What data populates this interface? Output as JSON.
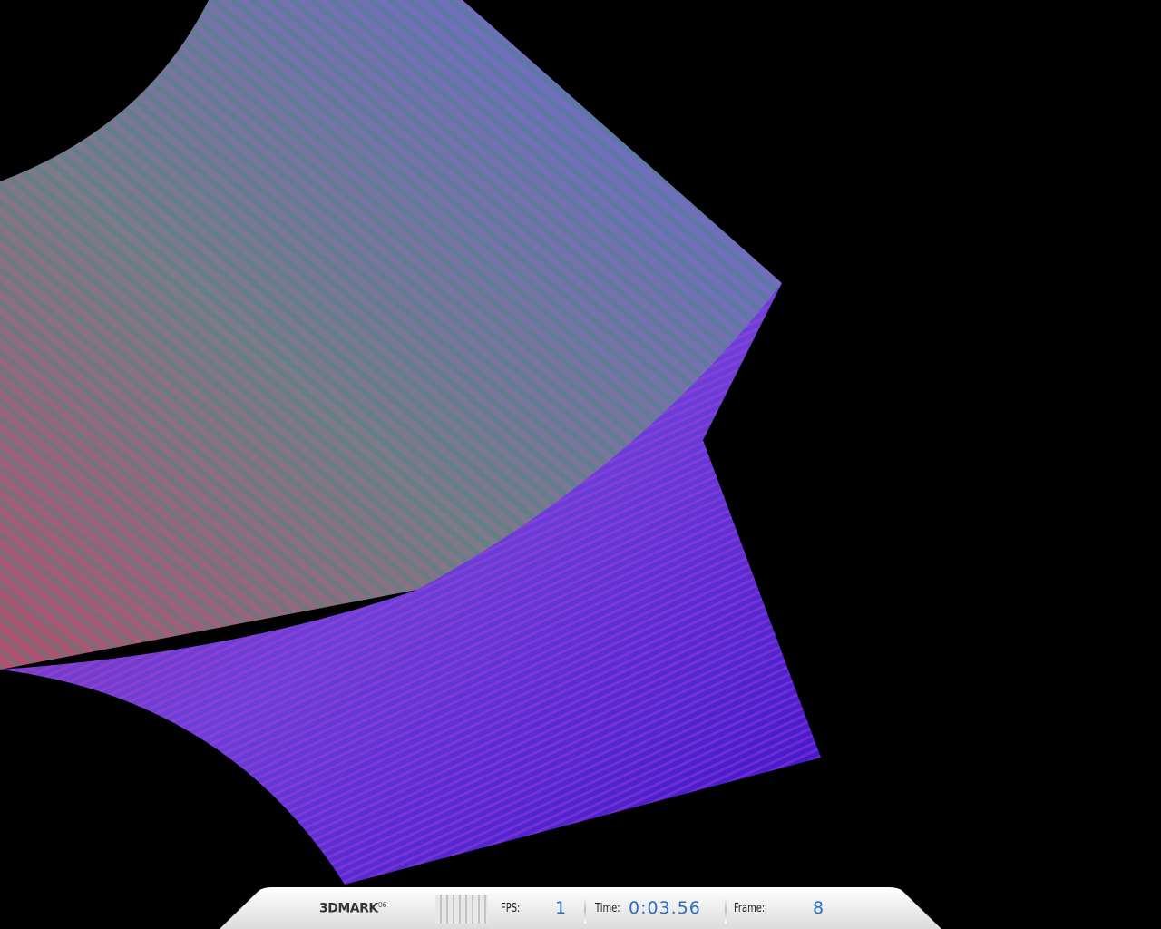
{
  "hud": {
    "logo": "3DMARK",
    "logo_version": "06",
    "fps_label": "FPS:",
    "fps_value": "1",
    "time_label": "Time:",
    "time_value": "0:03.56",
    "frame_label": "Frame:",
    "frame_value": "8"
  },
  "colors": {
    "accent": "#2a6fc0",
    "background": "#000000"
  }
}
